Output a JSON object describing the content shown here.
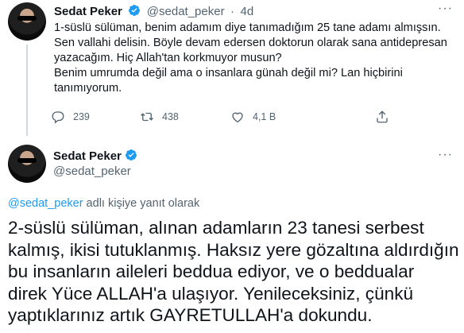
{
  "tweet1": {
    "author_name": "Sedat Peker",
    "author_handle": "@sedat_peker",
    "separator": "·",
    "time": "4d",
    "more_label": "···",
    "lines": [
      "1-süslü sülüman, benim adamım diye tanımadığım 25 tane adamı almışsın.",
      "Sen vallahi delisin. Böyle devam edersen doktorun olarak sana antidepresan",
      "yazacağım. Hiç Allah'tan korkmuyor musun?",
      "Benim umrumda değil ama o insanlara günah değil mi? Lan hiçbirini",
      "tanımıyorum."
    ],
    "reply_count": "239",
    "retweet_count": "438",
    "like_count": "4,1 B"
  },
  "tweet2": {
    "author_name": "Sedat Peker",
    "author_handle": "@sedat_peker",
    "more_label": "···",
    "replying_mention": "@sedat_peker",
    "replying_suffix": " adlı kişiye yanıt olarak",
    "lines": [
      "2-süslü sülüman, alınan adamların 23 tanesi serbest",
      "kalmış, ikisi tutuklanmış. Haksız yere gözaltına aldırdığın",
      "bu insanların aileleri beddua ediyor, ve o beddualar",
      "direk Yüce ALLAH'a ulaşıyor. Yenileceksiniz, çünkü",
      "yaptıklarınız artık GAYRETULLAH'a dokundu."
    ]
  },
  "colors": {
    "accent": "#1d9bf0",
    "muted": "#536471",
    "text": "#0f1419",
    "line": "#cfd9de"
  },
  "icons": [
    "verified-badge-icon",
    "reply-icon",
    "retweet-icon",
    "like-icon",
    "share-icon",
    "more-icon"
  ]
}
